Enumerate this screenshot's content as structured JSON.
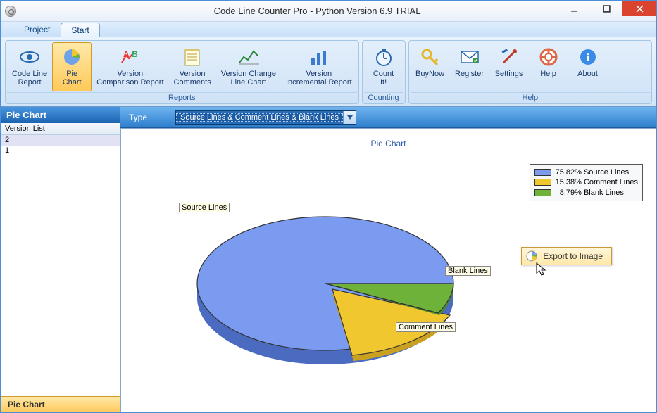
{
  "window": {
    "title": "Code Line Counter Pro - Python Version 6.9 TRIAL"
  },
  "tabs": {
    "project": "Project",
    "start": "Start"
  },
  "ribbon": {
    "codeLineReport": "Code Line\nReport",
    "pieChart": "Pie\nChart",
    "versionComparison": "Version\nComparison Report",
    "versionComments": "Version\nComments",
    "versionChangeLine": "Version Change\nLine Chart",
    "versionIncremental": "Version\nIncremental Report",
    "countIt": "Count\nIt!",
    "buyNow": "BuyNow",
    "register": "Register",
    "settings": "Settings",
    "help": "Help",
    "about": "About",
    "group_reports": "Reports",
    "group_counting": "Counting",
    "group_help": "Help"
  },
  "typebar": {
    "label": "Type",
    "value": "Source Lines & Comment Lines & Blank Lines"
  },
  "sidebar": {
    "title": "Pie Chart",
    "col": "Version List",
    "rows": [
      "2",
      "1"
    ],
    "bottomTab": "Pie Chart"
  },
  "chart": {
    "title": "Pie Chart",
    "legend": [
      {
        "pct": "75.82%",
        "label": "Source Lines",
        "color": "#7a9bf0"
      },
      {
        "pct": "15.38%",
        "label": "Comment Lines",
        "color": "#f1c72f"
      },
      {
        "pct": "8.79%",
        "label": "Blank Lines",
        "color": "#6fb23a"
      }
    ],
    "sliceLabels": {
      "source": "Source Lines",
      "comment": "Comment Lines",
      "blank": "Blank Lines"
    }
  },
  "context": {
    "exportToImage": "Export to Image"
  },
  "chart_data": {
    "type": "pie",
    "title": "Pie Chart",
    "series": [
      {
        "name": "Source Lines",
        "value": 75.82,
        "color": "#7a9bf0"
      },
      {
        "name": "Comment Lines",
        "value": 15.38,
        "color": "#f1c72f"
      },
      {
        "name": "Blank Lines",
        "value": 8.79,
        "color": "#6fb23a"
      }
    ]
  }
}
